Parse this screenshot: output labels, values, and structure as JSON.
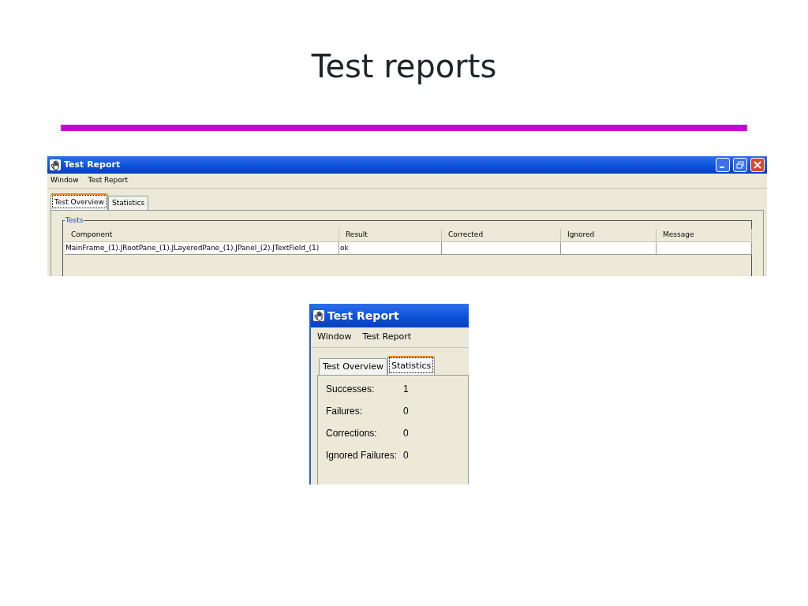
{
  "slide_title": "Test reports",
  "report_window": {
    "title": "Test Report",
    "menu": [
      "Window",
      "Test Report"
    ],
    "tabs": [
      {
        "label": "Test Overview",
        "selected": true
      },
      {
        "label": "Statistics",
        "selected": false
      }
    ],
    "group_title": "Tests",
    "table": {
      "columns": [
        "Component",
        "Result",
        "Corrected",
        "Ignored",
        "Message"
      ],
      "rows": [
        {
          "component": "MainFrame_(1).JRootPane_(1).JLayeredPane_(1).JPanel_(2).JTextField_(1)",
          "result": "ok"
        }
      ]
    }
  },
  "statistics_window": {
    "title": "Test Report",
    "menu": [
      "Window",
      "Test Report"
    ],
    "tabs": [
      {
        "label": "Test Overview",
        "selected": false
      },
      {
        "label": "Statistics",
        "selected": true
      }
    ],
    "stats": [
      {
        "label": "Successes:",
        "value": "1"
      },
      {
        "label": "Failures:",
        "value": "0"
      },
      {
        "label": "Corrections:",
        "value": "0"
      },
      {
        "label": "Ignored Failures:",
        "value": "0"
      }
    ]
  }
}
